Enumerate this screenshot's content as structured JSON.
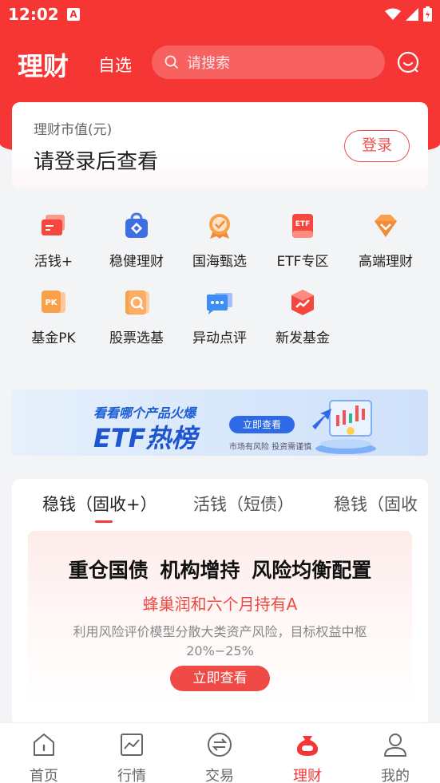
{
  "status": {
    "time": "12:02",
    "badge": "A"
  },
  "header": {
    "title": "理财",
    "watchlist": "自选",
    "search_placeholder": "请搜索"
  },
  "asset_card": {
    "label": "理财市值(元)",
    "value": "请登录后查看",
    "login_label": "登录"
  },
  "features": [
    {
      "label": "活钱+",
      "icon": "cards-icon"
    },
    {
      "label": "稳健理财",
      "icon": "lock-bag-icon"
    },
    {
      "label": "国海甄选",
      "icon": "medal-icon"
    },
    {
      "label": "ETF专区",
      "icon": "etf-icon"
    },
    {
      "label": "高端理财",
      "icon": "diamond-icon"
    },
    {
      "label": "基金PK",
      "icon": "pk-icon"
    },
    {
      "label": "股票选基",
      "icon": "search-doc-icon"
    },
    {
      "label": "异动点评",
      "icon": "chat-bubbles-icon"
    },
    {
      "label": "新发基金",
      "icon": "new-fund-icon"
    }
  ],
  "banner": {
    "line1": "看看哪个产品火爆",
    "line2": "ETF热榜",
    "button": "立即查看",
    "risk": "市场有风险 投资需谨慎"
  },
  "tabs": [
    {
      "label": "稳钱（固收+）",
      "active": true
    },
    {
      "label": "活钱（短债）",
      "active": false
    },
    {
      "label": "稳钱（固收",
      "active": false
    }
  ],
  "promo": {
    "headline": "重仓国债 机构增持 风险均衡配置",
    "product": "蜂巢润和六个月持有A",
    "desc": "利用风险评价模型分散大类资产风险，目标权益中枢20%−25%",
    "cta": "立即查看"
  },
  "bottom_nav": [
    {
      "label": "首页",
      "icon": "home-icon",
      "active": false
    },
    {
      "label": "行情",
      "icon": "chart-icon",
      "active": false
    },
    {
      "label": "交易",
      "icon": "exchange-icon",
      "active": false
    },
    {
      "label": "理财",
      "icon": "money-bag-icon",
      "active": true
    },
    {
      "label": "我的",
      "icon": "user-icon",
      "active": false
    }
  ],
  "colors": {
    "brand": "#f53634",
    "accent_blue": "#1d56d0"
  }
}
